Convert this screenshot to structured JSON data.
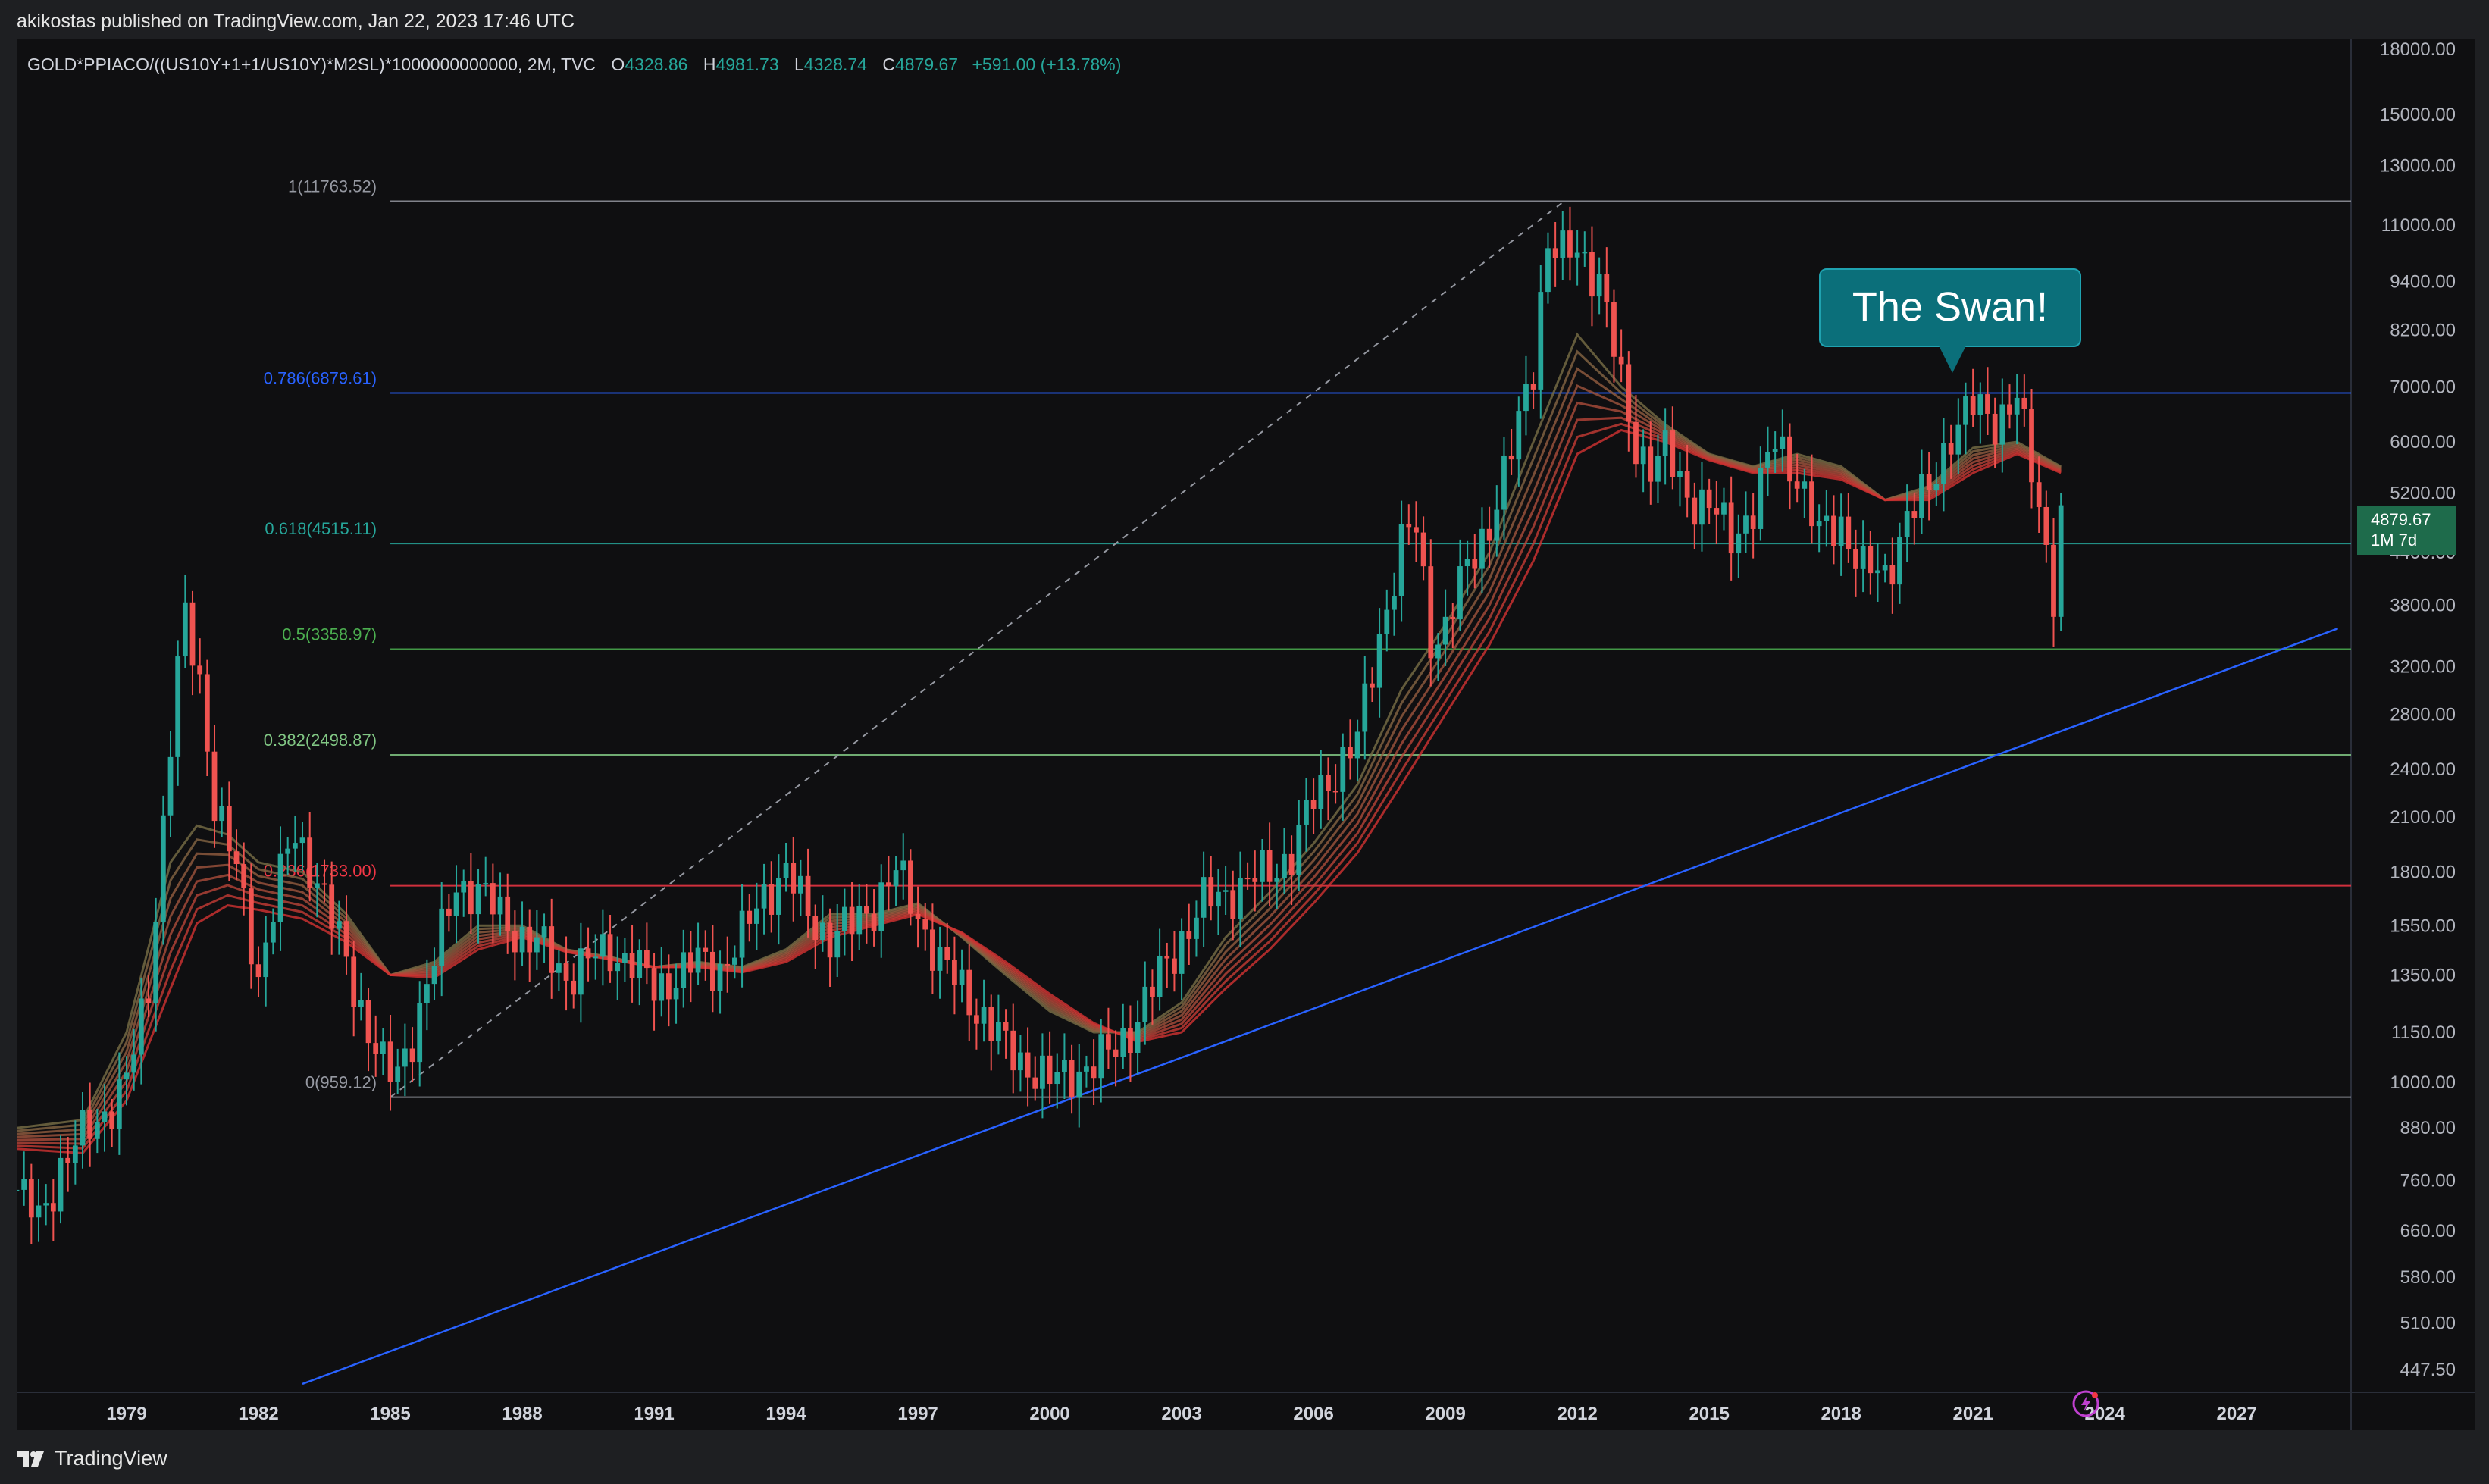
{
  "header": {
    "published": "akikostas published on TradingView.com, Jan 22, 2023 17:46 UTC"
  },
  "symbol": {
    "name": "GOLD*PPIACO/((US10Y+1+1/US10Y)*M2SL)*1000000000000, 2M, TVC",
    "open_label": "O",
    "open": "4328.86",
    "high_label": "H",
    "high": "4981.73",
    "low_label": "L",
    "low": "4328.74",
    "close_label": "C",
    "close": "4879.67",
    "change": "+591.00 (+13.78%)"
  },
  "price_tag": {
    "price": "4879.67",
    "countdown": "1M 7d"
  },
  "annotation": {
    "text": "The Swan!"
  },
  "footer": {
    "brand": "TradingView",
    "logo_icon": "tradingview-logo-icon",
    "bolt_icon": "lightning-bolt-icon"
  },
  "colors": {
    "background": "#0f0f11",
    "up": "#26a69a",
    "down": "#ef5350",
    "trendline": "#2962ff",
    "annotation": "#0b6f7a",
    "price_tag": "#1e6b4b"
  },
  "chart_data": {
    "type": "candlestick",
    "scale": "log",
    "ylim": [
      420,
      18500
    ],
    "xlim": [
      1976.5,
      2029.6
    ],
    "y_ticks": [
      "18000.00",
      "15000.00",
      "13000.00",
      "11000.00",
      "9400.00",
      "8200.00",
      "7000.00",
      "6000.00",
      "5200.00",
      "4400.00",
      "3800.00",
      "3200.00",
      "2800.00",
      "2400.00",
      "2100.00",
      "1800.00",
      "1550.00",
      "1350.00",
      "1150.00",
      "1000.00",
      "880.00",
      "760.00",
      "660.00",
      "580.00",
      "510.00",
      "447.50"
    ],
    "x_ticks": [
      "1979",
      "1982",
      "1985",
      "1988",
      "1991",
      "1994",
      "1997",
      "2000",
      "2003",
      "2006",
      "2009",
      "2012",
      "2015",
      "2018",
      "2021",
      "2024",
      "2027"
    ],
    "fibonacci": {
      "anchor_low": {
        "x": 1985.0,
        "y": 959.12
      },
      "anchor_high": {
        "x": 2011.7,
        "y": 11763.52
      },
      "levels": [
        {
          "label": "1(11763.52)",
          "value": 11763.52,
          "color": "#9598a1"
        },
        {
          "label": "0.786(6879.61)",
          "value": 6879.61,
          "color": "#2962ff"
        },
        {
          "label": "0.618(4515.11)",
          "value": 4515.11,
          "color": "#26a69a"
        },
        {
          "label": "0.5(3358.97)",
          "value": 3358.97,
          "color": "#4caf50"
        },
        {
          "label": "0.382(2498.87)",
          "value": 2498.87,
          "color": "#81c784"
        },
        {
          "label": "0.236(1733.00)",
          "value": 1733.0,
          "color": "#f23645"
        },
        {
          "label": "0(959.12)",
          "value": 959.12,
          "color": "#9598a1"
        }
      ]
    },
    "trendline": {
      "from": {
        "x": 1983.0,
        "y": 430
      },
      "to": {
        "x": 2029.3,
        "y": 3560
      }
    },
    "close_series": {
      "x": [
        1976.5,
        1977,
        1977.5,
        1978,
        1978.5,
        1979,
        1979.5,
        1980,
        1980.3,
        1980.7,
        1981,
        1981.5,
        1982,
        1982.4,
        1982.8,
        1983.3,
        1983.8,
        1984.3,
        1984.8,
        1985.1,
        1985.5,
        1986,
        1986.5,
        1987,
        1987.5,
        1988,
        1988.5,
        1989,
        1989.5,
        1990,
        1990.5,
        1991,
        1991.5,
        1992,
        1992.5,
        1993,
        1993.5,
        1994,
        1994.5,
        1995,
        1995.5,
        1996,
        1996.5,
        1997,
        1997.5,
        1998,
        1998.5,
        1999,
        1999.5,
        2000,
        2000.5,
        2001,
        2001.5,
        2002,
        2002.5,
        2003,
        2003.5,
        2004,
        2004.5,
        2005,
        2005.5,
        2006,
        2006.5,
        2007,
        2007.5,
        2008,
        2008.3,
        2008.7,
        2009,
        2009.5,
        2010,
        2010.5,
        2011,
        2011.3,
        2011.7,
        2012,
        2012.5,
        2013,
        2013.3,
        2013.7,
        2014,
        2014.5,
        2015,
        2015.5,
        2016,
        2016.5,
        2017,
        2017.5,
        2018,
        2018.5,
        2019,
        2019.5,
        2020,
        2020.5,
        2021,
        2021.5,
        2022,
        2022.3,
        2022.6,
        2022.9,
        2023.0
      ],
      "y": [
        740,
        680,
        790,
        860,
        920,
        1000,
        1300,
        2600,
        3700,
        3000,
        2200,
        1800,
        1350,
        1700,
        2000,
        1800,
        1500,
        1250,
        1050,
        1000,
        1150,
        1400,
        1750,
        1700,
        1600,
        1500,
        1450,
        1350,
        1400,
        1450,
        1400,
        1300,
        1350,
        1400,
        1380,
        1500,
        1700,
        1800,
        1600,
        1500,
        1550,
        1650,
        1800,
        1600,
        1400,
        1300,
        1200,
        1100,
        1050,
        1000,
        1030,
        1050,
        1100,
        1200,
        1350,
        1500,
        1650,
        1700,
        1750,
        1800,
        1900,
        2200,
        2400,
        2600,
        3500,
        4500,
        4800,
        3400,
        3600,
        4200,
        4800,
        5800,
        7500,
        10500,
        10000,
        10300,
        9500,
        7000,
        6000,
        5600,
        5800,
        5200,
        5000,
        4600,
        5000,
        6000,
        5500,
        4600,
        4800,
        4200,
        4100,
        4900,
        5200,
        6200,
        6600,
        6400,
        6800,
        5600,
        4700,
        3800,
        4880
      ]
    },
    "ribbon_series": {
      "x": [
        1976.5,
        1978,
        1979,
        1980,
        1980.6,
        1981.3,
        1982,
        1983,
        1984,
        1985,
        1986,
        1987,
        1988,
        1989,
        1990,
        1991,
        1992,
        1993,
        1994,
        1995,
        1996,
        1997,
        1998,
        1999,
        2000,
        2001,
        2002,
        2003,
        2004,
        2005,
        2006,
        2007,
        2008,
        2009,
        2010,
        2011,
        2012,
        2013,
        2014,
        2015,
        2016,
        2017,
        2018,
        2019,
        2020,
        2021,
        2022,
        2023.0
      ],
      "fast": [
        880,
        900,
        1150,
        1850,
        2050,
        2000,
        1850,
        1800,
        1600,
        1350,
        1400,
        1550,
        1550,
        1450,
        1420,
        1380,
        1400,
        1380,
        1450,
        1600,
        1600,
        1650,
        1500,
        1350,
        1220,
        1150,
        1150,
        1250,
        1500,
        1700,
        1950,
        2300,
        3000,
        3600,
        4400,
        6000,
        8100,
        7000,
        6300,
        5800,
        5600,
        5800,
        5600,
        5100,
        5300,
        5900,
        6000,
        5600
      ],
      "slow": [
        830,
        820,
        950,
        1300,
        1560,
        1640,
        1620,
        1580,
        1480,
        1350,
        1340,
        1450,
        1500,
        1440,
        1410,
        1380,
        1380,
        1360,
        1400,
        1500,
        1550,
        1600,
        1520,
        1400,
        1280,
        1180,
        1120,
        1150,
        1300,
        1450,
        1650,
        1900,
        2300,
        2800,
        3400,
        4300,
        5800,
        6200,
        6000,
        5700,
        5500,
        5500,
        5400,
        5100,
        5100,
        5500,
        5800,
        5500
      ]
    }
  }
}
